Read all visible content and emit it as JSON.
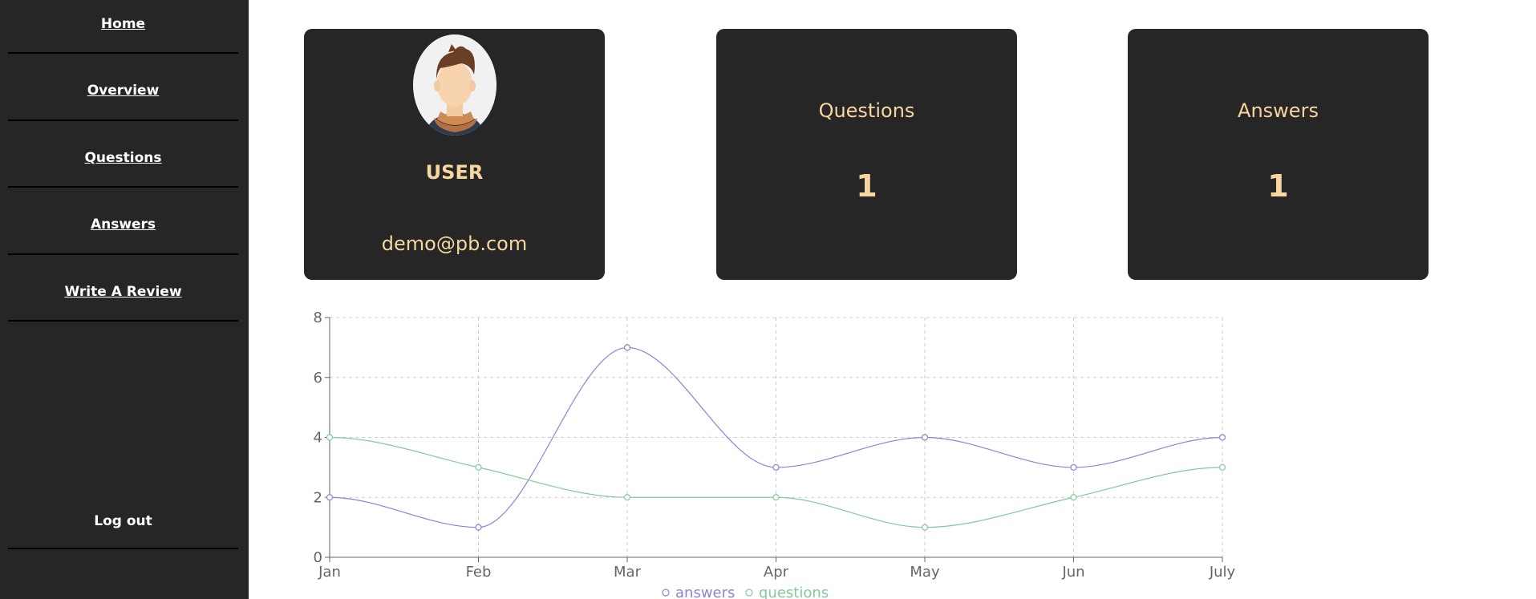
{
  "sidebar": {
    "items": [
      {
        "label": "Home"
      },
      {
        "label": "Overview"
      },
      {
        "label": "Questions"
      },
      {
        "label": "Answers"
      },
      {
        "label": "Write A Review"
      }
    ],
    "logout_label": "Log out"
  },
  "profile": {
    "name": "USER",
    "email": "demo@pb.com"
  },
  "stats": {
    "questions": {
      "label": "Questions",
      "value": "1"
    },
    "answers": {
      "label": "Answers",
      "value": "1"
    }
  },
  "colors": {
    "sidebar_bg": "#262626",
    "card_bg": "#262626",
    "card_text": "#f7d6a0",
    "answers_line": "#8884d8",
    "questions_line": "#82ca9d"
  },
  "chart_data": {
    "type": "line",
    "categories": [
      "Jan",
      "Feb",
      "Mar",
      "Apr",
      "May",
      "Jun",
      "July"
    ],
    "series": [
      {
        "name": "answers",
        "values": [
          2,
          1,
          7,
          3,
          4,
          3,
          4
        ],
        "color": "#8884d8"
      },
      {
        "name": "questions",
        "values": [
          4,
          3,
          2,
          2,
          1,
          2,
          3
        ],
        "color": "#82ca9d"
      }
    ],
    "ylim": [
      0,
      8
    ],
    "yticks": [
      0,
      2,
      4,
      6,
      8
    ],
    "grid": true,
    "legend": "bottom"
  }
}
